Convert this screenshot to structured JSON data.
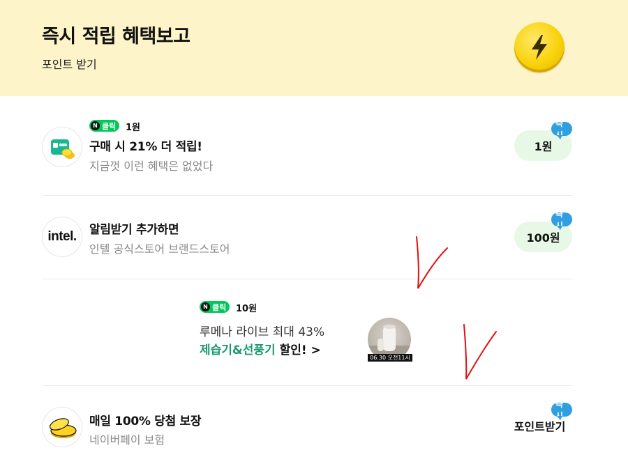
{
  "header": {
    "title": "즉시 적립 혜택보고",
    "subtitle": "포인트 받기",
    "icon": "lightning-coin-icon"
  },
  "items": [
    {
      "chip_label": "클릭",
      "chip_amount": "1원",
      "title": "구매 시 21% 더 적립!",
      "description": "지금껏 이런 혜택은 없었다",
      "reward": "1원",
      "badge": "즉시",
      "logo": "naver-shopping-logo"
    },
    {
      "title": "알림받기 추가하면",
      "description": "인텔 공식스토어 브랜드스토어",
      "reward": "100원",
      "badge": "즉시",
      "logo_text": "intel."
    },
    {
      "title": "매일 100% 당첨 보장",
      "description": "네이버페이 보험",
      "reward": "포인트받기",
      "badge": "즉시",
      "logo": "gold-coins-logo"
    }
  ],
  "ad": {
    "chip_label": "클릭",
    "chip_amount": "10원",
    "line1": "루메나 라이브 최대 43%",
    "line2_highlight": "제습기&선풍기",
    "line2_rest": " 할인! >",
    "thumb_caption": "06.30 오전11시"
  },
  "colors": {
    "hero_bg": "#fdf5c9",
    "naver_green": "#03c75a",
    "reward_bg": "#e8f8e6",
    "badge_blue": "#2f9fe0",
    "ad_highlight": "#1a9a6c",
    "annotation_red": "#e01010"
  }
}
